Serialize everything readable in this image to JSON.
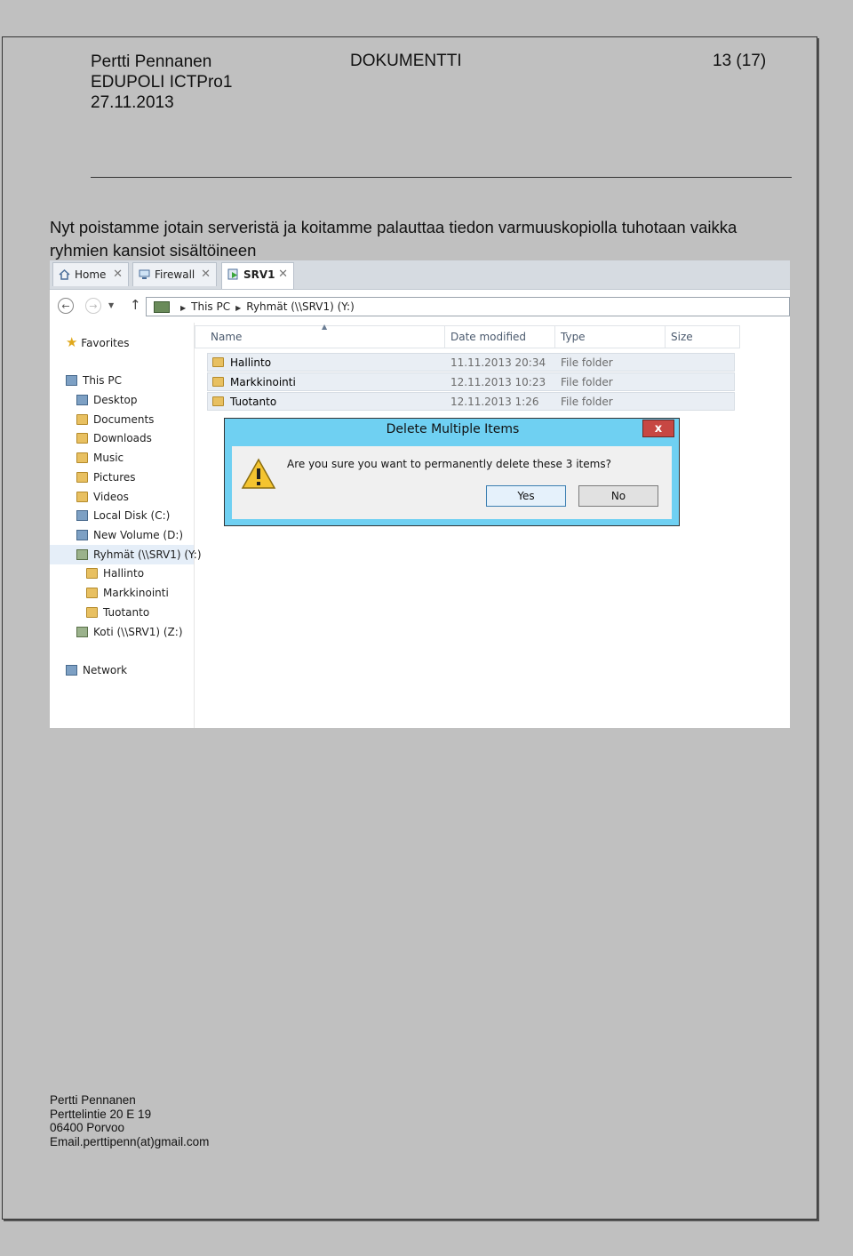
{
  "header": {
    "author": "Pertti Pennanen",
    "org": "EDUPOLI ICTPro1",
    "date": "27.11.2013",
    "doc_type": "DOKUMENTTI",
    "page": "13 (17)"
  },
  "intro_text": "Nyt poistamme jotain serveristä ja koitamme palauttaa tiedon varmuuskopiolla tuhotaan vaikka ryhmien kansiot sisältöineen",
  "explorer": {
    "tabs": [
      {
        "label": "Home"
      },
      {
        "label": "Firewall"
      },
      {
        "label": "SRV1"
      }
    ],
    "address": {
      "segments": [
        "This PC",
        "Ryhmät (\\\\SRV1) (Y:)"
      ]
    },
    "tree": {
      "favorites": "Favorites",
      "this_pc": "This PC",
      "desktop": "Desktop",
      "documents": "Documents",
      "downloads": "Downloads",
      "music": "Music",
      "pictures": "Pictures",
      "videos": "Videos",
      "local_disk": "Local Disk (C:)",
      "new_volume": "New Volume (D:)",
      "ryhmat": "Ryhmät (\\\\SRV1) (Y:)",
      "hallinto": "Hallinto",
      "markkinointi": "Markkinointi",
      "tuotanto": "Tuotanto",
      "koti": "Koti (\\\\SRV1) (Z:)",
      "network": "Network"
    },
    "columns": {
      "name": "Name",
      "date": "Date modified",
      "type": "Type",
      "size": "Size"
    },
    "files": [
      {
        "name": "Hallinto",
        "date": "11.11.2013 20:34",
        "type": "File folder"
      },
      {
        "name": "Markkinointi",
        "date": "12.11.2013 10:23",
        "type": "File folder"
      },
      {
        "name": "Tuotanto",
        "date": "12.11.2013 1:26",
        "type": "File folder"
      }
    ],
    "dialog": {
      "title": "Delete Multiple Items",
      "close": "x",
      "message": "Are you sure you want to permanently delete these 3 items?",
      "yes": "Yes",
      "no": "No"
    }
  },
  "footer": {
    "name": "Pertti Pennanen",
    "street": "Perttelintie 20 E 19",
    "city": "06400 Porvoo",
    "email": "Email.perttipenn(at)gmail.com"
  }
}
